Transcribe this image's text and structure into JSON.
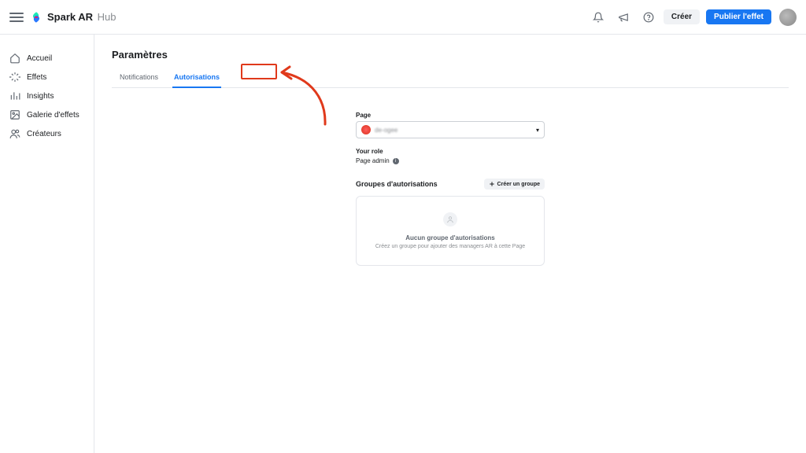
{
  "app": {
    "name": "Spark AR",
    "suffix": "Hub"
  },
  "header_actions": {
    "create_label": "Créer",
    "publish_label": "Publier l'effet"
  },
  "sidebar": {
    "items": [
      {
        "label": "Accueil"
      },
      {
        "label": "Effets"
      },
      {
        "label": "Insights"
      },
      {
        "label": "Galerie d'effets"
      },
      {
        "label": "Créateurs"
      }
    ]
  },
  "page": {
    "title": "Paramètres",
    "tabs": [
      {
        "label": "Notifications"
      },
      {
        "label": "Autorisations"
      }
    ]
  },
  "permissions": {
    "page_field_label": "Page",
    "page_name": "de-ogee",
    "role_label": "Your role",
    "role_value": "Page admin",
    "groups_title": "Groupes d'autorisations",
    "create_group_label": "Créer un groupe",
    "empty_title": "Aucun groupe d'autorisations",
    "empty_sub": "Créez un groupe pour ajouter des managers AR à cette Page"
  }
}
